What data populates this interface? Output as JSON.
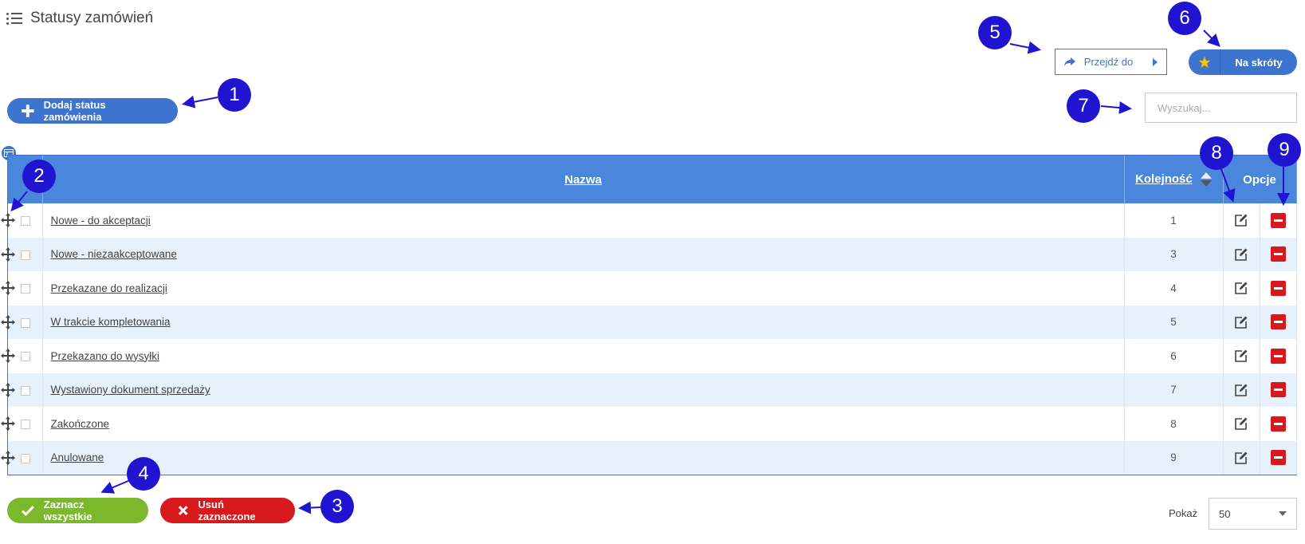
{
  "header": {
    "title": "Statusy zamówień"
  },
  "toolbar": {
    "add_label": "Dodaj status zamówienia",
    "goto_label": "Przejdź do",
    "shortcuts_label": "Na skróty",
    "search_placeholder": "Wyszukaj..."
  },
  "table": {
    "columns": {
      "name": "Nazwa",
      "order": "Kolejność",
      "options": "Opcje"
    },
    "rows": [
      {
        "name": "Nowe - do akceptacji",
        "order": "1"
      },
      {
        "name": "Nowe - niezaakceptowane",
        "order": "3"
      },
      {
        "name": "Przekazane do realizacji",
        "order": "4"
      },
      {
        "name": "W trakcie kompletowania",
        "order": "5"
      },
      {
        "name": "Przekazano do wysyłki",
        "order": "6"
      },
      {
        "name": "Wystawiony dokument sprzedaży",
        "order": "7"
      },
      {
        "name": "Zakończone",
        "order": "8"
      },
      {
        "name": "Anulowane",
        "order": "9"
      }
    ]
  },
  "footer": {
    "select_all_label": "Zaznacz wszystkie",
    "delete_selected_label": "Usuń zaznaczone",
    "show_label": "Pokaż",
    "page_size": "50"
  },
  "callouts": [
    "1",
    "2",
    "3",
    "4",
    "5",
    "6",
    "7",
    "8",
    "9"
  ],
  "colors": {
    "primary": "#3c74cf",
    "table_header": "#4a86dc",
    "row_alt": "#e7f1fc",
    "success": "#7cb82b",
    "danger": "#d7181d",
    "callout": "#2014d1"
  }
}
